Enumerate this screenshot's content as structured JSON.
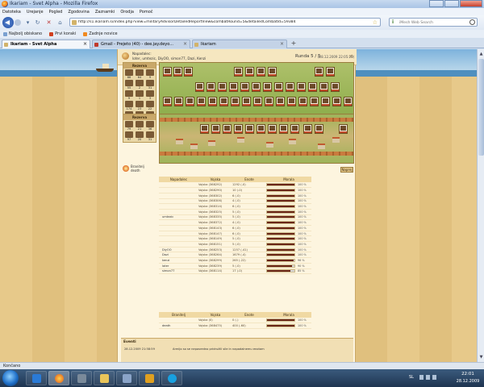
{
  "window": {
    "title": "Ikariam - Svet Alpha - Mozilla Firefox"
  },
  "menu": [
    "Datoteka",
    "Urejanje",
    "Pogled",
    "Zgodovina",
    "Zaznamki",
    "Orodja",
    "Pomoč"
  ],
  "address": {
    "url": "http://s1.ikariam.si/index.php?view=militaryAdvisorDetailedReportView&combatRound=5&detailedCombatId=59384",
    "search_placeholder": "iMesh Web Search"
  },
  "bookmarks": [
    "Najbolj obiskano",
    "Prvi koraki",
    "Zadnje novice"
  ],
  "tabs": [
    {
      "label": "Ikariam - Svet Alpha",
      "active": true
    },
    {
      "label": "Gmail - Prejeto (40) - dee.jay.deyo...",
      "active": false
    },
    {
      "label": "Ikariam",
      "active": false
    }
  ],
  "report": {
    "header_line1": "Napadalec:",
    "header_line2": "loter, umtezic, DiyOO, simon77, Dazi, Kenzi",
    "round_label": "Runda 5 / 5",
    "round_date": "(28.12.2009 22:05:29)",
    "round_nav": "◁",
    "reserve_label": "Rezerva",
    "reserve_attacker": [
      "88",
      "64",
      "9",
      "55",
      "2",
      "31",
      "9",
      "1",
      "3",
      "174",
      "23",
      "22",
      "161",
      "19",
      "13",
      "145",
      "267",
      "374"
    ],
    "reserve_defender": [
      "79",
      "21",
      "36",
      "97",
      "20",
      "31"
    ],
    "combat_lines": [
      "Branitelj",
      "death"
    ],
    "next_label": "Naprej"
  },
  "attackers_table": {
    "headers": [
      "Napadalec",
      "Vojska",
      "Enote",
      "Morala"
    ],
    "rows": [
      {
        "player": "",
        "army": "Vojska (368292)",
        "units": "1292 (-0)",
        "morale": "100 %",
        "morale_value": 100
      },
      {
        "player": "",
        "army": "Vojska (368290)",
        "units": "10 (-0)",
        "morale": "100 %",
        "morale_value": 100
      },
      {
        "player": "",
        "army": "Vojska (368302)",
        "units": "6 (-0)",
        "morale": "100 %",
        "morale_value": 100
      },
      {
        "player": "",
        "army": "Vojska (368306)",
        "units": "4 (-0)",
        "morale": "100 %",
        "morale_value": 100
      },
      {
        "player": "",
        "army": "Vojska (368314)",
        "units": "6 (-0)",
        "morale": "100 %",
        "morale_value": 100
      },
      {
        "player": "",
        "army": "Vojska (368325)",
        "units": "5 (-0)",
        "morale": "100 %",
        "morale_value": 100
      },
      {
        "player": "umtezic",
        "army": "Vojska (368335)",
        "units": "5 (-0)",
        "morale": "100 %",
        "morale_value": 100
      },
      {
        "player": "",
        "army": "Vojska (368372)",
        "units": "4 (-0)",
        "morale": "100 %",
        "morale_value": 100
      },
      {
        "player": "",
        "army": "Vojska (368143)",
        "units": "6 (-0)",
        "morale": "100 %",
        "morale_value": 100
      },
      {
        "player": "",
        "army": "Vojska (368147)",
        "units": "6 (-0)",
        "morale": "100 %",
        "morale_value": 100
      },
      {
        "player": "",
        "army": "Vojska (368149)",
        "units": "5 (-0)",
        "morale": "100 %",
        "morale_value": 100
      },
      {
        "player": "",
        "army": "Vojska (368151)",
        "units": "5 (-0)",
        "morale": "100 %",
        "morale_value": 100
      },
      {
        "player": "DiyOO",
        "army": "Vojska (368253)",
        "units": "1257 (-41)",
        "morale": "100 %",
        "morale_value": 100
      },
      {
        "player": "Dazi",
        "army": "Vojska (368264)",
        "units": "1679 (-4)",
        "morale": "100 %",
        "morale_value": 100
      },
      {
        "player": "kenzi",
        "army": "Vojska (368299)",
        "units": "265 (-22)",
        "morale": "96 %",
        "morale_value": 96
      },
      {
        "player": "loter",
        "army": "Vojska (368239)",
        "units": "5 (-0)",
        "morale": "90 %",
        "morale_value": 90
      },
      {
        "player": "simon77",
        "army": "Vojska (368114)",
        "units": "17 (-0)",
        "morale": "85 %",
        "morale_value": 85
      }
    ]
  },
  "defenders_table": {
    "headers": [
      "Branitelj",
      "Vojska",
      "Enote",
      "Morala"
    ],
    "rows": [
      {
        "player": "",
        "army": "Vojska (0)",
        "units": "0 (-)",
        "morale": "100 %",
        "morale_value": 100
      },
      {
        "player": "death",
        "army": "Vojska (368475)",
        "units": "400 (-60)",
        "morale": "100 %",
        "morale_value": 100
      }
    ]
  },
  "events": {
    "title": "Eventi",
    "date": "28.12.2009 21:58:59",
    "text": "Armijo so se neposredno pridružili sile in napadalnemu enotam"
  },
  "status": "Končano",
  "taskbar": {
    "lang": "SL",
    "time": "22:01",
    "date": "28.12.2009"
  },
  "colors": {
    "morale_fill": "#6a2618",
    "page_bg": "#fdf5df",
    "header_bg": "#f0d9a3"
  }
}
